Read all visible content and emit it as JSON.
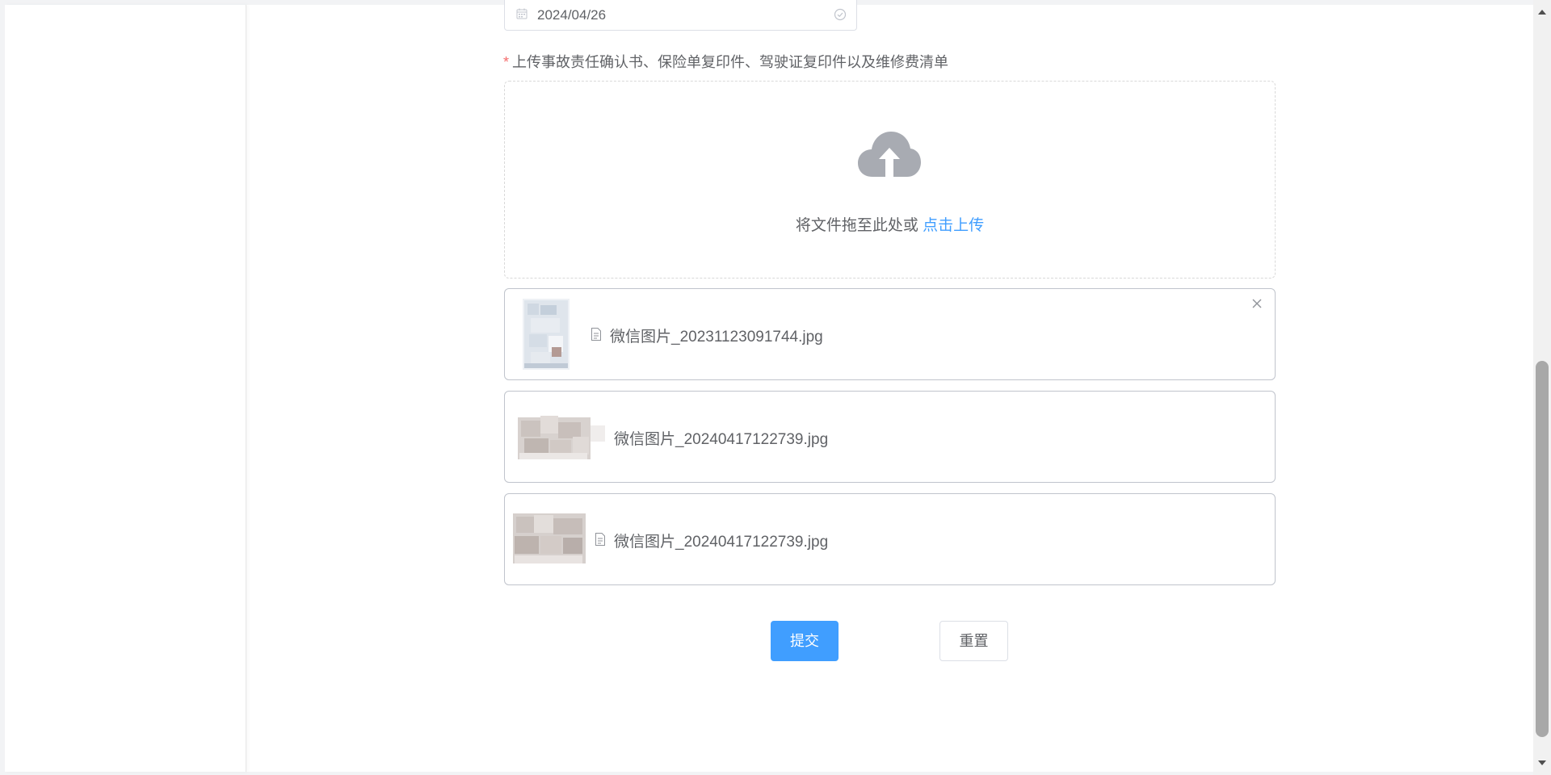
{
  "form": {
    "date_value": "2024/04/26",
    "upload_required_mark": "*",
    "upload_label": "上传事故责任确认书、保险单复印件、驾驶证复印件以及维修费清单",
    "dropzone": {
      "hint_text": "将文件拖至此处或",
      "link_text": "点击上传",
      "icon": "cloud-upload-icon"
    },
    "files": [
      {
        "name": "微信图片_20231123091744.jpg",
        "has_doc_icon": true,
        "removable": true
      },
      {
        "name": "微信图片_20240417122739.jpg",
        "has_doc_icon": false,
        "removable": false
      },
      {
        "name": "微信图片_20240417122739.jpg",
        "has_doc_icon": true,
        "removable": false
      }
    ],
    "buttons": {
      "submit_label": "提交",
      "reset_label": "重置"
    }
  },
  "colors": {
    "primary": "#409eff",
    "required": "#f56c6c",
    "text": "#606266",
    "border": "#dcdfe6"
  }
}
